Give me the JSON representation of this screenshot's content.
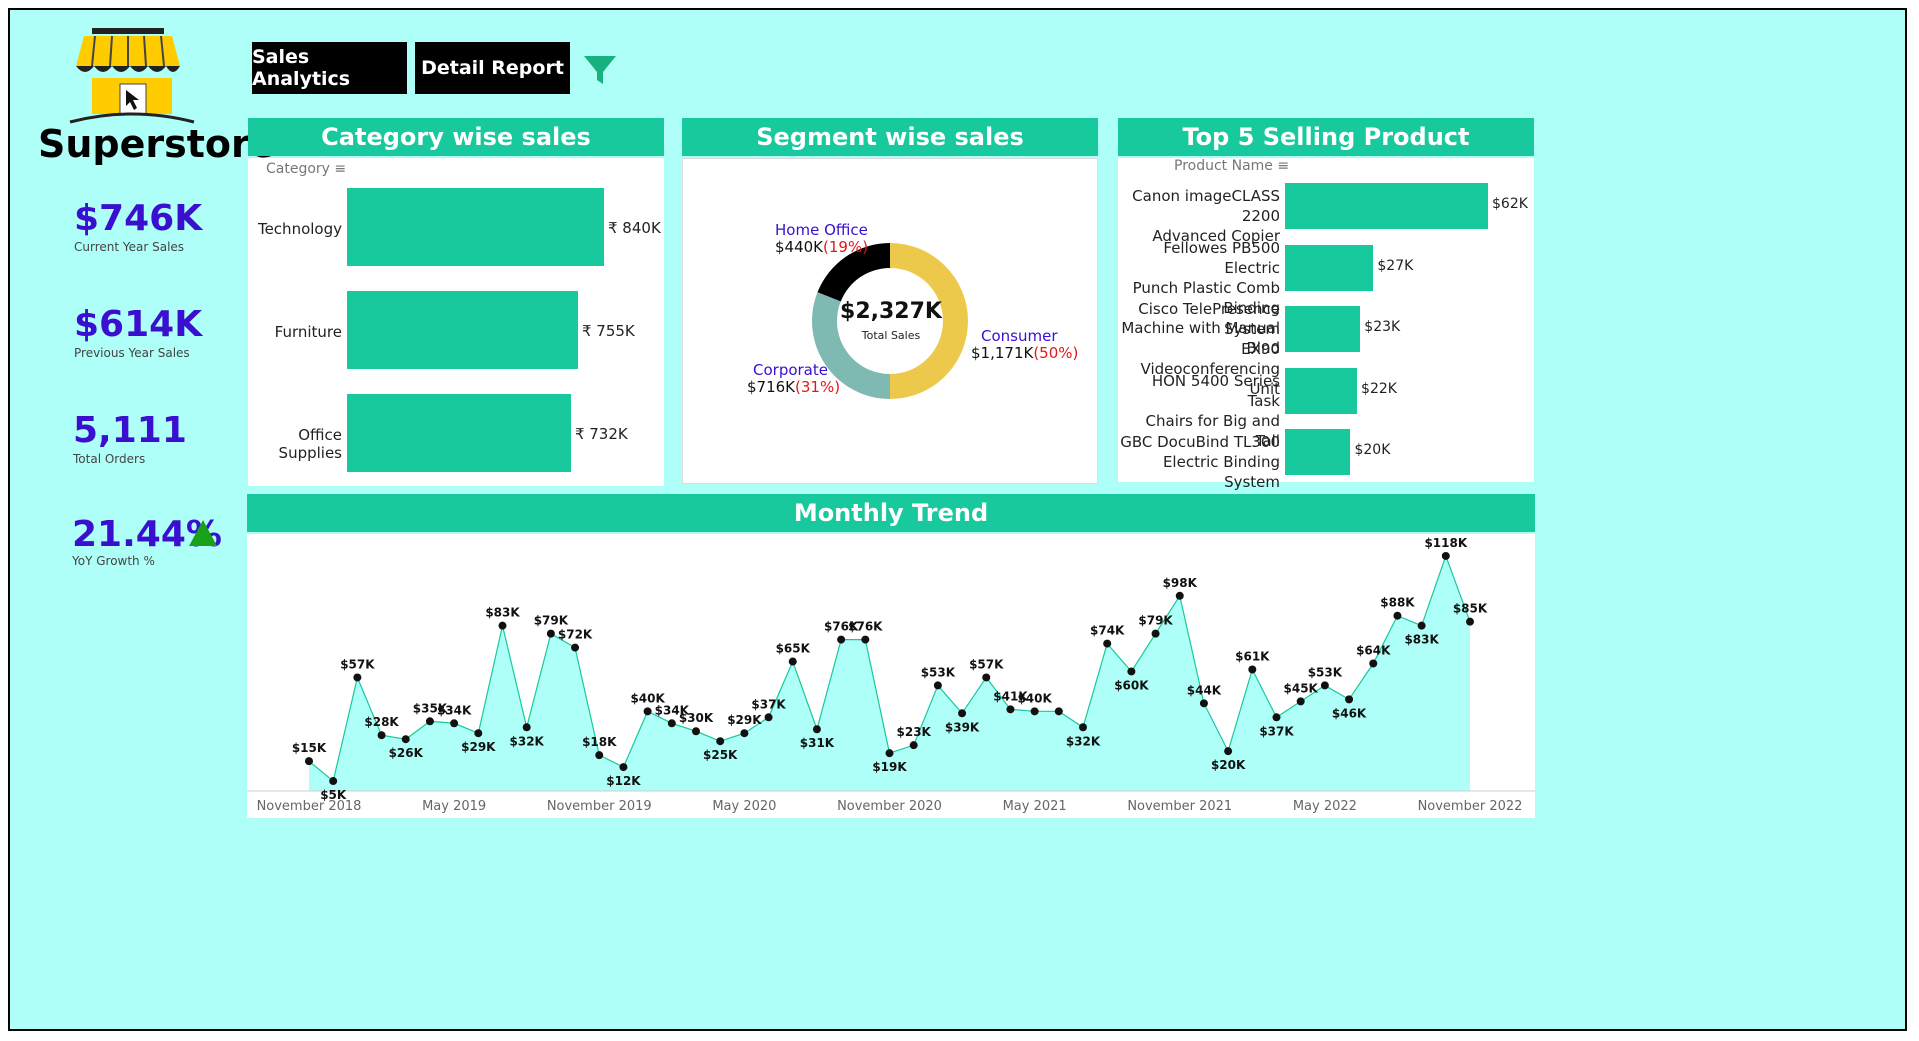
{
  "app": {
    "title": "Superstore"
  },
  "nav": {
    "sales_analytics": "Sales Analytics",
    "detail_report": "Detail Report"
  },
  "kpis": [
    {
      "value": "$746K",
      "label": "Current Year Sales"
    },
    {
      "value": "$614K",
      "label": "Previous Year Sales"
    },
    {
      "value": "5,111",
      "label": "Total Orders"
    },
    {
      "value": "21.44%",
      "label": "YoY Growth %"
    }
  ],
  "colors": {
    "background": "#aefff8",
    "accent": "#17c99c",
    "kpi": "#3a0fd0",
    "consumer": "#ecc94b",
    "corporate": "#7fbab2",
    "home_office": "#000000",
    "growth_up": "#1aa11a"
  },
  "category_panel": {
    "title": "Category wise sales",
    "field_label": "Category",
    "items": [
      {
        "name": "Technology",
        "value_label": "₹ 840K",
        "value": 840
      },
      {
        "name": "Furniture",
        "value_label": "₹ 755K",
        "value": 755
      },
      {
        "name": "Office Supplies",
        "value_label": "₹ 732K",
        "value": 732
      }
    ]
  },
  "segment_panel": {
    "title": "Segment wise sales",
    "total_value": "$2,327K",
    "total_label": "Total Sales",
    "segments": [
      {
        "name": "Home Office",
        "value": "$440K",
        "pct": "(19%)",
        "share": 19
      },
      {
        "name": "Consumer",
        "value": "$1,171K",
        "pct": "(50%)",
        "share": 50
      },
      {
        "name": "Corporate",
        "value": "$716K",
        "pct": "(31%)",
        "share": 31
      }
    ]
  },
  "product_panel": {
    "title": "Top 5 Selling Product",
    "field_label": "Product Name",
    "items": [
      {
        "lines": [
          "Canon imageCLASS 2200",
          "Advanced Copier"
        ],
        "value_label": "$62K",
        "value": 62
      },
      {
        "lines": [
          "Fellowes PB500 Electric",
          "Punch Plastic Comb Binding",
          "Machine with Manual Bind"
        ],
        "value_label": "$27K",
        "value": 27
      },
      {
        "lines": [
          "Cisco TelePresence System",
          "EX90 Videoconferencing",
          "Unit"
        ],
        "value_label": "$23K",
        "value": 23
      },
      {
        "lines": [
          "HON 5400 Series Task",
          "Chairs for Big and Tall"
        ],
        "value_label": "$22K",
        "value": 22
      },
      {
        "lines": [
          "GBC DocuBind TL300",
          "Electric Binding System"
        ],
        "value_label": "$20K",
        "value": 20
      }
    ]
  },
  "trend_panel": {
    "title": "Monthly Trend"
  },
  "chart_data": {
    "type": "area",
    "title": "Monthly Trend",
    "x_start": "November 2018",
    "x_tick_labels": [
      "November 2018",
      "May 2019",
      "November 2019",
      "May 2020",
      "November 2020",
      "May 2021",
      "November 2021",
      "May 2022",
      "November 2022"
    ],
    "values": [
      15,
      5,
      57,
      28,
      26,
      35,
      34,
      29,
      83,
      32,
      79,
      72,
      18,
      12,
      40,
      34,
      30,
      25,
      29,
      37,
      65,
      31,
      76,
      76,
      19,
      23,
      53,
      39,
      57,
      41,
      40,
      40,
      32,
      74,
      60,
      79,
      98,
      44,
      20,
      61,
      37,
      45,
      53,
      46,
      64,
      88,
      83,
      118,
      85
    ],
    "labels": [
      "$15K",
      "$5K",
      "$57K",
      "$28K",
      "$26K",
      "$35K",
      "$34K",
      "$29K",
      "$83K",
      "$32K",
      "$79K",
      "$72K",
      "$18K",
      "$12K",
      "$40K",
      "$34K",
      "$30K",
      "$25K",
      "$29K",
      "$37K",
      "$65K",
      "$31K",
      "$76K",
      "$76K",
      "$19K",
      "$23K",
      "$53K",
      "$39K",
      "$57K",
      "$41K",
      "$40K",
      "",
      "$32K",
      "$74K",
      "$60K",
      "$79K",
      "$98K",
      "$44K",
      "$20K",
      "$61K",
      "$37K",
      "$45K",
      "$53K",
      "$46K",
      "$64K",
      "$88K",
      "$83K",
      "$118K",
      "$85K"
    ],
    "ylim": [
      0,
      125
    ],
    "grid": false
  }
}
